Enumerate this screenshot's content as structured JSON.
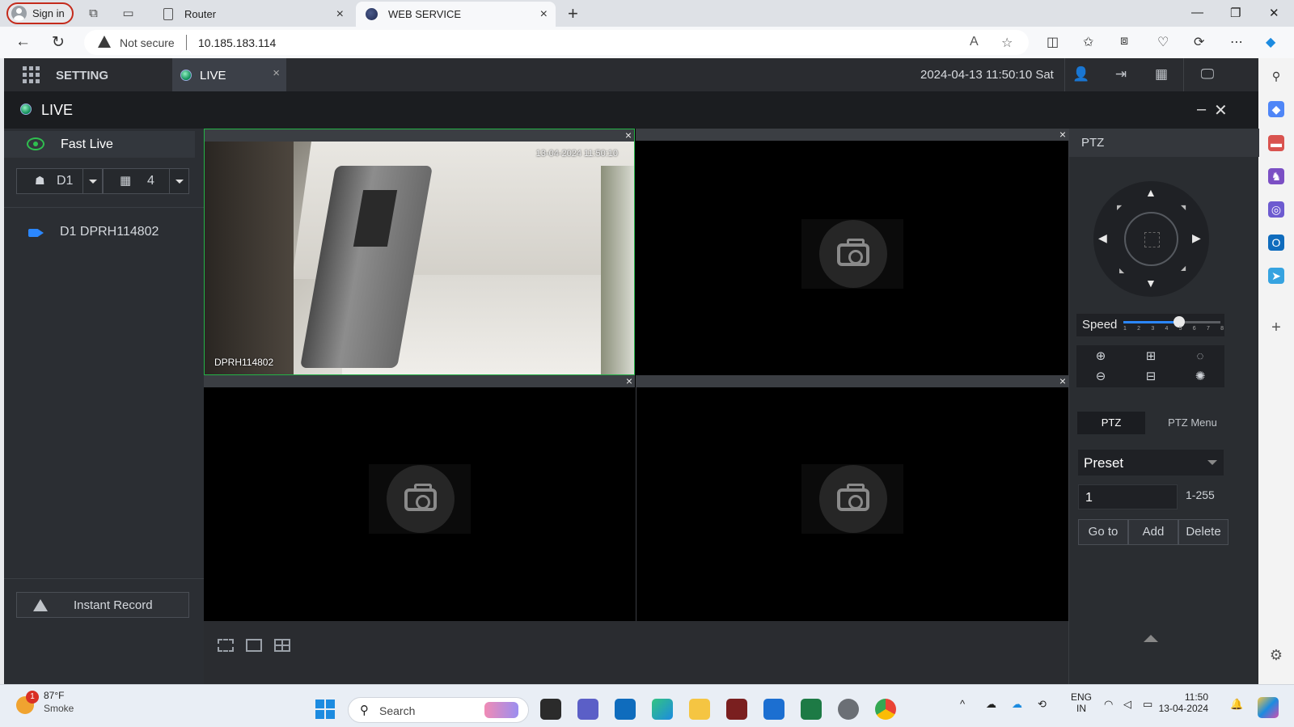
{
  "browser": {
    "signin_label": "Sign in",
    "tabs": [
      {
        "title": "Router",
        "close": "×"
      },
      {
        "title": "WEB SERVICE",
        "close": "×"
      }
    ],
    "new_tab": "+",
    "window_controls": {
      "minimize": "—",
      "restore": "❐",
      "close": "✕"
    },
    "security_label": "Not secure",
    "url": "10.185.183.114"
  },
  "app": {
    "setting_label": "SETTING",
    "live_tab_label": "LIVE",
    "live_tab_close": "×",
    "datetime": "2024-04-13 11:50:10 Sat",
    "live_header": "LIVE",
    "left_panel": {
      "fast_live": "Fast Live",
      "device_select": "D1",
      "split_select": "4",
      "device_item": "D1 DPRH114802",
      "instant_record": "Instant Record"
    },
    "video": {
      "cell1_osd_time": "13-04-2024 11:50:10",
      "cell1_osd_name": "DPRH114802",
      "close_glyph": "×"
    },
    "ptz": {
      "title": "PTZ",
      "speed_label": "Speed",
      "speed_value": 5,
      "speed_ticks": [
        "1",
        "2",
        "3",
        "4",
        "5",
        "6",
        "7",
        "8"
      ],
      "tab_ptz": "PTZ",
      "tab_ptz_menu": "PTZ Menu",
      "preset_label": "Preset",
      "preset_value": "1",
      "preset_range": "1-255",
      "btn_goto": "Go to",
      "btn_add": "Add",
      "btn_delete": "Delete"
    }
  },
  "taskbar": {
    "weather_badge": "1",
    "temperature": "87°F",
    "condition": "Smoke",
    "search_placeholder": "Search",
    "language": "ENG",
    "region": "IN",
    "time": "11:50",
    "date": "13-04-2024"
  },
  "colors": {
    "accent_green": "#24b347",
    "signin_border": "#c42b1c",
    "device_icon": "#2b87ff"
  }
}
